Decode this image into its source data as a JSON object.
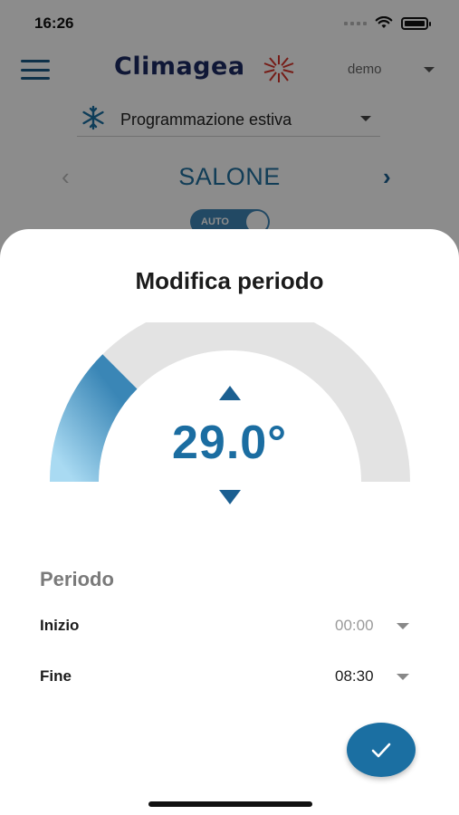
{
  "status_bar": {
    "time": "16:26"
  },
  "header": {
    "logo_text": "Climagea",
    "user": "demo"
  },
  "program": {
    "label": "Programmazione estiva",
    "icon": "snowflake-icon"
  },
  "room": {
    "name": "SALONE",
    "prev_icon": "chevron-left-icon",
    "next_icon": "chevron-right-icon"
  },
  "mode_toggle": {
    "label": "AUTO"
  },
  "sheet": {
    "title": "Modifica periodo",
    "temperature": "29.0°",
    "gauge_fill_fraction": 0.25,
    "period_title": "Periodo",
    "start": {
      "label": "Inizio",
      "value": "00:00"
    },
    "end": {
      "label": "Fine",
      "value": "08:30"
    }
  },
  "colors": {
    "accent": "#1b6fa2",
    "gauge_track": "#e3e3e3",
    "gauge_fill_start": "#a9daf2",
    "gauge_fill_end": "#3a86b6",
    "muted_value": "#9a9a9a"
  }
}
